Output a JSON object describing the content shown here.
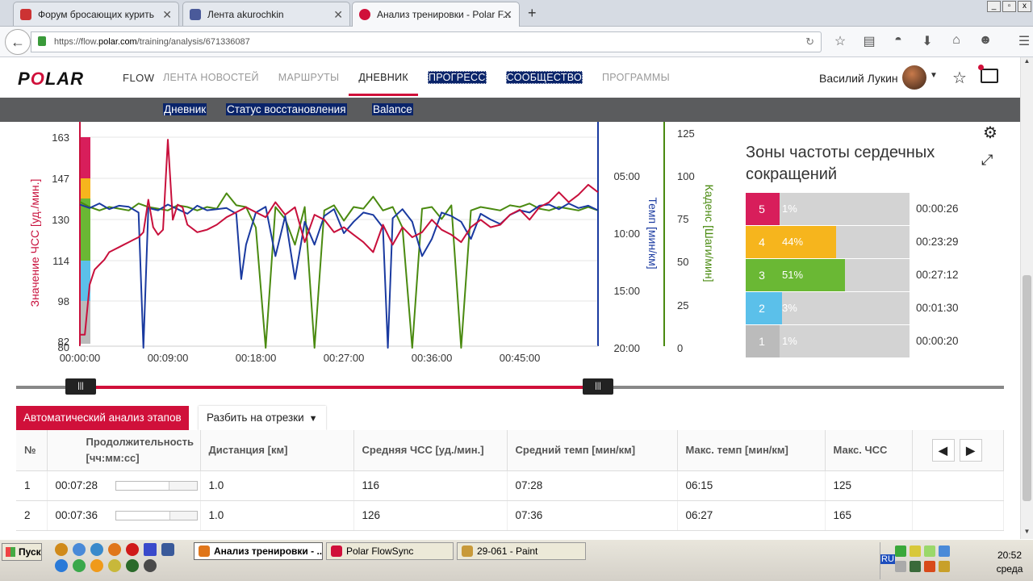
{
  "browser": {
    "tabs": [
      {
        "title": "Форум бросающих курить",
        "active": false
      },
      {
        "title": "Лента akurochkin",
        "active": false
      },
      {
        "title": "Анализ тренировки - Polar F...",
        "active": true
      }
    ],
    "url_prefix": "https://flow.",
    "url_domain": "polar.com",
    "url_path": "/training/analysis/671336087"
  },
  "header": {
    "logo": "POLAR",
    "product": "FLOW",
    "nav": [
      {
        "label": "ЛЕНТА НОВОСТЕЙ",
        "state": "normal"
      },
      {
        "label": "МАРШРУТЫ",
        "state": "normal"
      },
      {
        "label": "ДНЕВНИК",
        "state": "current"
      },
      {
        "label": "ПРОГРЕСС",
        "state": "highlight"
      },
      {
        "label": "СООБЩЕСТВО",
        "state": "highlight"
      },
      {
        "label": "ПРОГРАММЫ",
        "state": "normal"
      }
    ],
    "user_name": "Василий Лукин"
  },
  "subnav": {
    "items": [
      "Дневник",
      "Статус восстановления",
      "Balance"
    ]
  },
  "chart_data": {
    "type": "line",
    "x_ticks": [
      "00:00:00",
      "00:09:00",
      "00:18:00",
      "00:27:00",
      "00:36:00",
      "00:45:00"
    ],
    "left_axis": {
      "label": "Значение ЧСС [уд./мин.]",
      "ticks": [
        "163",
        "147",
        "130",
        "114",
        "98",
        "82",
        "80"
      ],
      "color": "#c8103c"
    },
    "right_axis_pace": {
      "label": "Темп [мин/км]",
      "ticks": [
        "05:00",
        "10:00",
        "15:00",
        "20:00"
      ],
      "color": "#1a3aa0"
    },
    "right_axis_cadence": {
      "label": "Каденс [Шаги/мин]",
      "ticks": [
        "125",
        "100",
        "75",
        "50",
        "25",
        "0"
      ],
      "color": "#4a8a10"
    },
    "series": [
      {
        "name": "Значение ЧСС",
        "x": [
          0,
          0.5,
          1,
          1.5,
          2,
          2.5,
          3,
          3.5,
          4,
          4.5,
          5,
          5.5,
          6,
          6.5,
          7,
          7.5,
          8,
          8.5,
          9,
          9.5,
          10,
          10.5,
          11,
          12,
          13,
          14,
          15,
          16,
          17,
          18,
          19,
          20,
          21,
          22,
          23,
          24,
          25,
          26,
          27,
          28,
          29,
          30,
          31,
          32,
          33,
          34,
          35,
          36,
          37,
          38,
          39,
          40,
          41,
          42,
          43,
          44,
          45,
          46,
          47,
          48,
          49,
          50,
          51,
          52,
          53
        ],
        "values": [
          84,
          84,
          104,
          110,
          112,
          114,
          117,
          118,
          119,
          120,
          121,
          122,
          123,
          125,
          138,
          127,
          124,
          126,
          162,
          130,
          136,
          135,
          128,
          125,
          126,
          128,
          131,
          133,
          135,
          133,
          131,
          137,
          132,
          135,
          121,
          132,
          130,
          125,
          127,
          124,
          121,
          117,
          128,
          120,
          127,
          123,
          125,
          130,
          126,
          124,
          121,
          127,
          130,
          127,
          128,
          132,
          134,
          130,
          135,
          137,
          141,
          137,
          140,
          144,
          141
        ]
      },
      {
        "name": "Темп",
        "x": [
          0,
          1,
          2,
          3,
          4,
          5,
          6,
          6.5,
          7,
          8,
          9,
          10,
          11,
          12,
          13,
          14,
          15,
          16,
          16.5,
          17,
          18,
          19,
          20,
          21,
          22,
          23,
          24,
          25,
          26,
          27,
          28,
          29,
          30,
          31,
          31.5,
          32,
          33,
          34,
          35,
          36,
          37,
          38,
          39,
          40,
          41,
          42,
          43,
          44,
          45,
          46,
          47,
          48,
          49,
          50,
          51,
          52,
          53
        ],
        "values": [
          7.5,
          7.8,
          7.4,
          7.9,
          7.6,
          7.7,
          8.2,
          20,
          7.8,
          8.0,
          7.5,
          7.9,
          8.3,
          7.6,
          8.0,
          7.9,
          7.8,
          8.3,
          14,
          11,
          8.2,
          7.7,
          12,
          8.5,
          14,
          9.0,
          11,
          8.5,
          7.9,
          10,
          9,
          8.2,
          8.4,
          9.5,
          20,
          8.7,
          7.9,
          9,
          12,
          10.5,
          8.2,
          8.5,
          9,
          10.5,
          8.3,
          8.8,
          9.2,
          8.4,
          8.0,
          8.2,
          7.6,
          7.5,
          7.9,
          7.4,
          7.8,
          7.6,
          8.0
        ]
      },
      {
        "name": "Каденс",
        "x": [
          0,
          1,
          2,
          3,
          4,
          5,
          6,
          7,
          8,
          9,
          10,
          11,
          12,
          13,
          14,
          15,
          16,
          17,
          18,
          19,
          20,
          21,
          22,
          23,
          24,
          25,
          26,
          27,
          28,
          29,
          30,
          31,
          32,
          33,
          34,
          35,
          36,
          37,
          38,
          39,
          40,
          41,
          42,
          43,
          44,
          45,
          46,
          47,
          48,
          49,
          50,
          51,
          52,
          53
        ],
        "values": [
          85,
          82,
          80,
          82,
          81,
          80,
          84,
          82,
          81,
          80,
          83,
          82,
          80,
          82,
          81,
          90,
          83,
          82,
          70,
          0,
          82,
          75,
          60,
          82,
          0,
          80,
          83,
          74,
          82,
          81,
          88,
          80,
          82,
          70,
          0,
          81,
          82,
          75,
          83,
          0,
          80,
          82,
          81,
          80,
          83,
          82,
          84,
          81,
          80,
          82,
          81,
          80,
          82,
          80
        ]
      }
    ],
    "xlim_minutes": [
      0,
      53
    ]
  },
  "zones": {
    "title": "Зоны частоты сердечных сокращений",
    "items": [
      {
        "zone": "5",
        "percent": 1,
        "label": "1%",
        "time": "00:00:26",
        "color": "#d81e5b"
      },
      {
        "zone": "4",
        "percent": 44,
        "label": "44%",
        "time": "00:23:29",
        "color": "#f6b51d"
      },
      {
        "zone": "3",
        "percent": 51,
        "label": "51%",
        "time": "00:27:12",
        "color": "#6ab834"
      },
      {
        "zone": "2",
        "percent": 3,
        "label": "3%",
        "time": "00:01:30",
        "color": "#5bc0ea"
      },
      {
        "zone": "1",
        "percent": 1,
        "label": "1%",
        "time": "00:00:20",
        "color": "#bbbbbb"
      }
    ]
  },
  "range": {
    "handle_label": "|||"
  },
  "laps": {
    "auto_label": "Автоматический анализ этапов",
    "split_label": "Разбить на отрезки",
    "columns": [
      "№",
      "Продолжительность [чч:мм:сс]",
      "Дистанция [км]",
      "Средняя ЧСС [уд./мин.]",
      "Средний темп [мин/км]",
      "Макс. темп [мин/км]",
      "Макс. ЧСС"
    ],
    "rows": [
      {
        "n": "1",
        "duration": "00:07:28",
        "bar": 0.66,
        "distance": "1.0",
        "avg_hr": "116",
        "avg_pace": "07:28",
        "max_pace": "06:15",
        "max_hr": "125"
      },
      {
        "n": "2",
        "duration": "00:07:36",
        "bar": 0.67,
        "distance": "1.0",
        "avg_hr": "126",
        "avg_pace": "07:36",
        "max_pace": "06:27",
        "max_hr": "165"
      }
    ]
  },
  "taskbar": {
    "start": "Пуск",
    "windows": [
      {
        "title": "Анализ тренировки - ...",
        "active": true
      },
      {
        "title": "Polar FlowSync",
        "active": false
      },
      {
        "title": "29-061 - Paint",
        "active": false
      }
    ],
    "lang": "RU",
    "time": "20:52",
    "day": "среда"
  }
}
